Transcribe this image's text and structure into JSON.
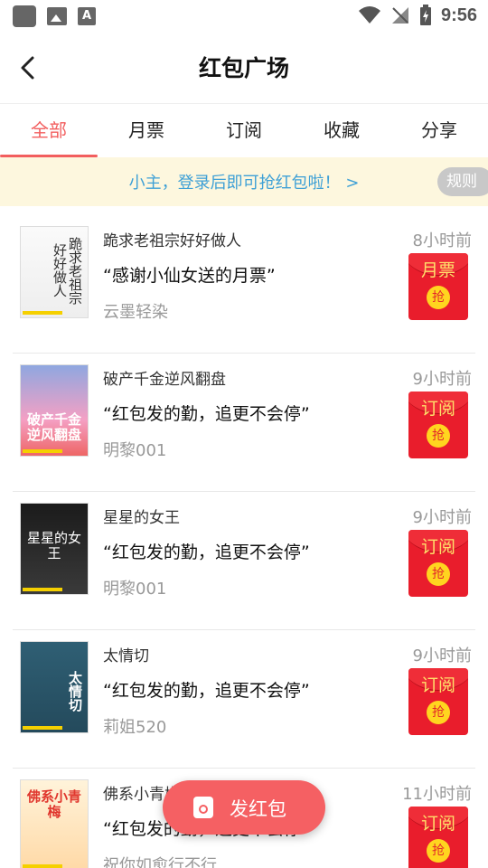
{
  "status_bar": {
    "time": "9:56"
  },
  "header": {
    "title": "红包广场"
  },
  "tabs": [
    {
      "label": "全部"
    },
    {
      "label": "月票"
    },
    {
      "label": "订阅"
    },
    {
      "label": "收藏"
    },
    {
      "label": "分享"
    }
  ],
  "notice": {
    "text": "小主，登录后即可抢红包啦！ >",
    "rule_label": "规则"
  },
  "items": [
    {
      "book_title": "跪求老祖宗好好做人",
      "time": "8小时前",
      "message": "“感谢小仙女送的月票”",
      "author": "云墨轻染",
      "type": "月票",
      "grab": "抢"
    },
    {
      "book_title": "破产千金逆风翻盘",
      "time": "9小时前",
      "message": "“红包发的勤，追更不会停”",
      "author": "明黎001",
      "type": "订阅",
      "grab": "抢"
    },
    {
      "book_title": "星星的女王",
      "time": "9小时前",
      "message": "“红包发的勤，追更不会停”",
      "author": "明黎001",
      "type": "订阅",
      "grab": "抢"
    },
    {
      "book_title": "太情切",
      "time": "9小时前",
      "message": "“红包发的勤，追更不会停”",
      "author": "莉姐520",
      "type": "订阅",
      "grab": "抢"
    },
    {
      "book_title": "佛系小青梅",
      "time": "11小时前",
      "message": "“红包发的勤，追更不会停”",
      "author": "祝你如愈行不行",
      "type": "订阅",
      "grab": "抢"
    }
  ],
  "fab": {
    "label": "发红包"
  },
  "colors": {
    "accent": "#f25e5e",
    "envelope": "#e91d2c",
    "notice_text": "#3ea0d6"
  }
}
